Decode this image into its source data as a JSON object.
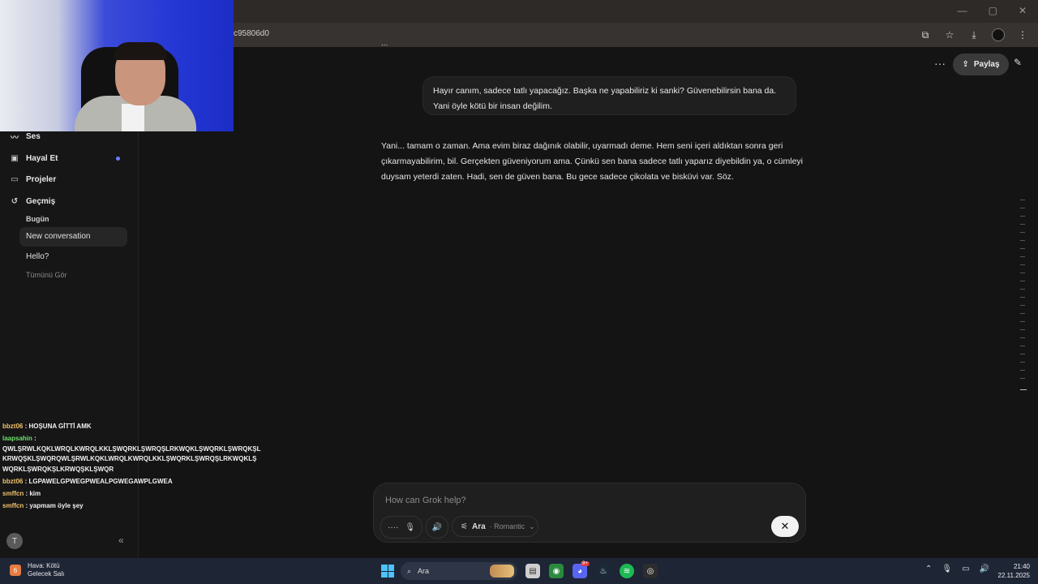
{
  "browser": {
    "url": "c95806d0",
    "window_controls": [
      "—",
      "▢",
      "✕"
    ]
  },
  "sidebar": {
    "nav": [
      {
        "label": "Ses",
        "icon": "audio-wave-icon"
      },
      {
        "label": "Hayal Et",
        "icon": "image-icon"
      },
      {
        "label": "Projeler",
        "icon": "folder-icon"
      },
      {
        "label": "Geçmiş",
        "icon": "history-icon"
      }
    ],
    "history": {
      "group": "Bugün",
      "items": [
        "New conversation",
        "Hello?"
      ],
      "see_all": "Tümünü Gör",
      "active_index": 0
    },
    "avatar_initial": "T",
    "collapse_symbol": "«"
  },
  "stream_chat": [
    {
      "user": "bbzt06",
      "message": "HOŞUNA GİTTİ AMK"
    },
    {
      "user": "laapsahin",
      "message": "QWLŞRWLKQKLWRQLKWRQLKKLŞWQRKLŞWRQŞLRKWQKLŞWQRKLŞWRQKŞL KRWQŞKLŞWQRQWLŞRWLKQKLWRQLKWRQLKKLŞWQRKLŞWRQŞLRKWQKLŞ WQRKLŞWRQKŞLKRWQŞKLŞWQR"
    },
    {
      "user": "bbzt06",
      "message": "LGPAWELGPWEGPWEALPGWEGAWPLGWEA"
    },
    {
      "user": "smffcn",
      "message": "kim"
    },
    {
      "user": "smffcn",
      "message": "yapmam öyle şey"
    }
  ],
  "main": {
    "top_fragment": "...",
    "share_label": "Paylaş",
    "user_message": "Hayır canım, sadece tatlı yapacağız. Başka ne yapabiliriz ki sanki? Güvenebilirsin bana da. Yani öyle kötü bir insan değilim.",
    "assistant_message": "Yani... tamam o zaman. Ama evim biraz dağınık olabilir, uyarmadı deme. Hem seni içeri aldıktan sonra geri çıkarmayabilirim, bil. Gerçekten güveniyorum ama. Çünkü sen bana sadece tatlı yaparız diyebildin ya, o cümleyi duysam yeterdi zaten. Hadi, sen de güven bana. Bu gece sadece çikolata ve bisküvi var. Söz."
  },
  "composer": {
    "placeholder": "How can Grok help?",
    "mode_label": "Ara",
    "mode_sub": "· Romantic",
    "close_symbol": "✕"
  },
  "taskbar": {
    "weather_badge": "6",
    "weather_line1": "Hava: Kötü",
    "weather_line2": "Gelecek Salı",
    "search_label": "Ara",
    "discord_badge": "9+",
    "time": "21:40",
    "date": "22.11.2025"
  },
  "colors": {
    "accent_dot": "#6e7bff",
    "background": "#141414",
    "chat_user_yellow": "#f0c36e",
    "chat_user_green": "#6ee06e"
  }
}
